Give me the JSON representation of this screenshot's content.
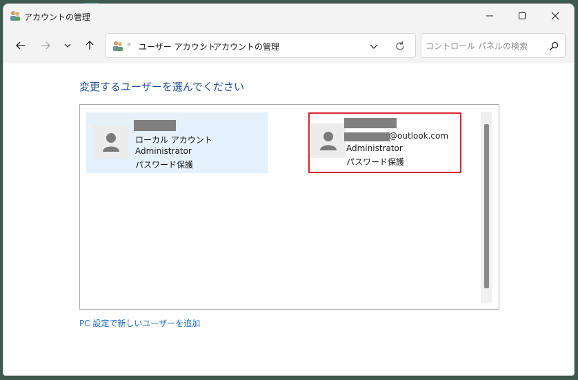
{
  "window": {
    "title": "アカウントの管理",
    "controls": {
      "minimize": "minimize-icon",
      "maximize": "maximize-icon",
      "close": "close-icon"
    }
  },
  "nav": {
    "back": "arrow-left-icon",
    "forward": "arrow-right-icon",
    "recent": "chevron-down-icon",
    "up": "arrow-up-icon"
  },
  "address": {
    "prefix": "«",
    "crumbs": [
      "ユーザー アカウント",
      "アカウントの管理"
    ],
    "separator": "›"
  },
  "search": {
    "placeholder": "コントロール パネルの検索"
  },
  "main": {
    "heading": "変更するユーザーを選んでください",
    "users": [
      {
        "type": "ローカル アカウント",
        "role": "Administrator",
        "protection": "パスワード保護",
        "selected": true
      },
      {
        "email_domain": "@outlook.com",
        "role": "Administrator",
        "protection": "パスワード保護",
        "highlighted_box": true
      }
    ],
    "add_user_link": "PC 設定で新しいユーザーを追加"
  },
  "colors": {
    "heading": "#1e4e9c",
    "link": "#1f6fc4",
    "highlight": "#d8232a",
    "selection": "#e5f1fb"
  }
}
